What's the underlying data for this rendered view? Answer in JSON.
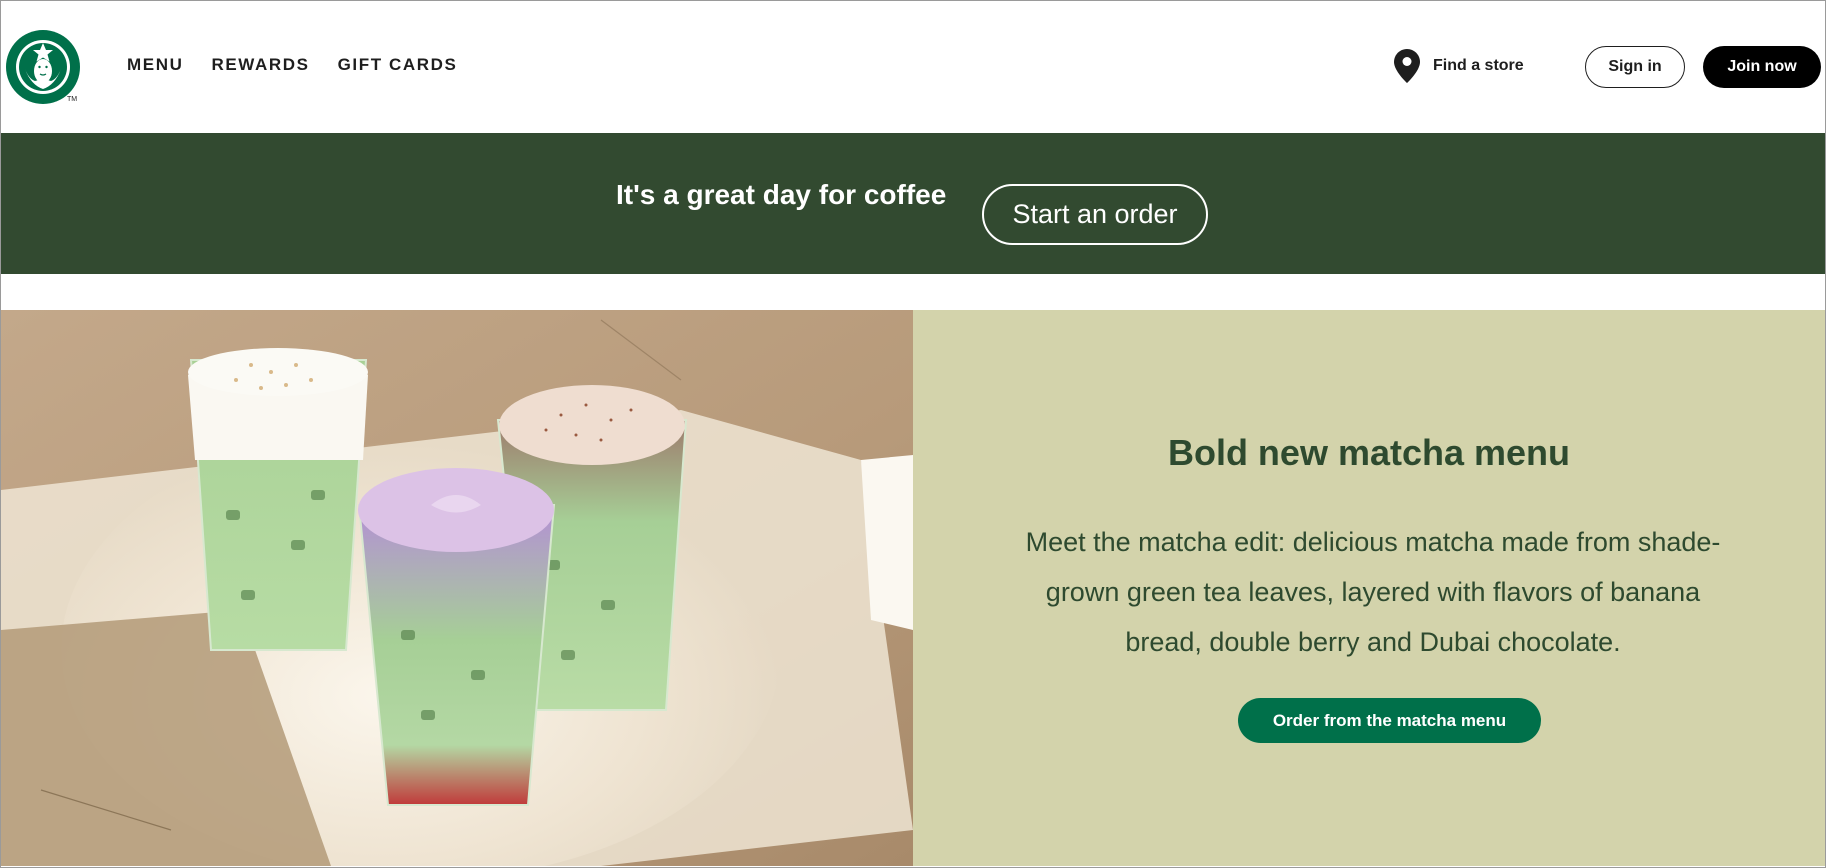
{
  "header": {
    "nav": [
      {
        "label": "MENU"
      },
      {
        "label": "REWARDS"
      },
      {
        "label": "GIFT CARDS"
      }
    ],
    "find_store_label": "Find a store",
    "sign_in_label": "Sign in",
    "join_label": "Join now",
    "trademark": "TM"
  },
  "banner": {
    "text": "It's a great day for coffee",
    "button_label": "Start an order"
  },
  "hero": {
    "title": "Bold new matcha menu",
    "body": "Meet the matcha edit: delicious matcha made from shade-grown green tea leaves, layered with flavors of banana bread, double berry and Dubai chocolate.",
    "button_label": "Order from the matcha menu"
  },
  "colors": {
    "brand_green": "#00704a",
    "banner_green": "#324a30",
    "hero_panel": "#d3d3ab",
    "hero_text": "#2e4a2f"
  }
}
